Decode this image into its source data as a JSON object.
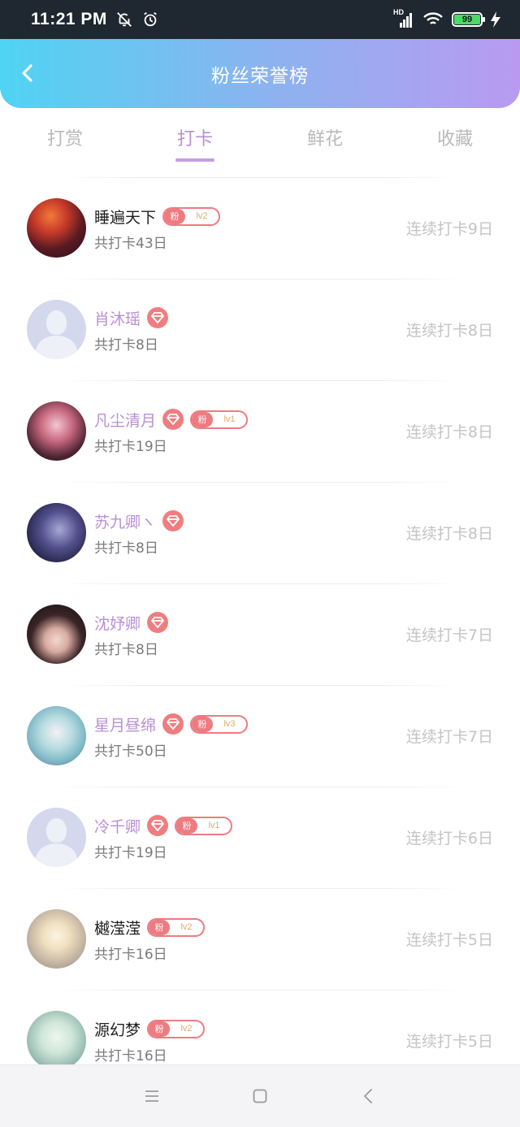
{
  "status_bar": {
    "time": "11:21 PM",
    "network": "HD",
    "battery": "99",
    "icons": [
      "bell-off-icon",
      "alarm-icon",
      "signal-icon",
      "wifi-icon",
      "battery-icon",
      "charging-icon"
    ]
  },
  "header": {
    "title": "粉丝荣誉榜",
    "back_icon": "chevron-left-icon"
  },
  "tabs": [
    {
      "label": "打赏",
      "active": false
    },
    {
      "label": "打卡",
      "active": true
    },
    {
      "label": "鲜花",
      "active": false
    },
    {
      "label": "收藏",
      "active": false
    }
  ],
  "colors": {
    "accent": "#b98fd3",
    "gradient_start": "#4fd4f2",
    "gradient_end": "#b99af0",
    "badge": "#ee7b80"
  },
  "fans": [
    {
      "name": "睡遍天下",
      "vip": false,
      "gem": false,
      "badge_label": "粉",
      "badge_level": "lv2",
      "total": "共打卡43日",
      "streak": "连续打卡9日"
    },
    {
      "name": "肖沐瑶",
      "vip": true,
      "gem": true,
      "badge_label": "",
      "badge_level": "",
      "total": "共打卡8日",
      "streak": "连续打卡8日"
    },
    {
      "name": "凡尘清月",
      "vip": true,
      "gem": true,
      "badge_label": "粉",
      "badge_level": "lv1",
      "total": "共打卡19日",
      "streak": "连续打卡8日"
    },
    {
      "name": "苏九卿ヽ",
      "vip": true,
      "gem": true,
      "badge_label": "",
      "badge_level": "",
      "total": "共打卡8日",
      "streak": "连续打卡8日"
    },
    {
      "name": "沈妤卿",
      "vip": true,
      "gem": true,
      "badge_label": "",
      "badge_level": "",
      "total": "共打卡8日",
      "streak": "连续打卡7日"
    },
    {
      "name": "星月昼绵",
      "vip": true,
      "gem": true,
      "badge_label": "粉",
      "badge_level": "lv3",
      "total": "共打卡50日",
      "streak": "连续打卡7日"
    },
    {
      "name": "冷千卿",
      "vip": true,
      "gem": true,
      "badge_label": "粉",
      "badge_level": "lv1",
      "total": "共打卡19日",
      "streak": "连续打卡6日"
    },
    {
      "name": "樾滢滢",
      "vip": false,
      "gem": false,
      "badge_label": "粉",
      "badge_level": "lv2",
      "total": "共打卡16日",
      "streak": "连续打卡5日"
    },
    {
      "name": "源幻梦",
      "vip": false,
      "gem": false,
      "badge_label": "粉",
      "badge_level": "lv2",
      "total": "共打卡16日",
      "streak": "连续打卡5日"
    }
  ],
  "nav_bar": {
    "icons": [
      "menu-icon",
      "home-square-icon",
      "back-triangle-icon"
    ]
  }
}
